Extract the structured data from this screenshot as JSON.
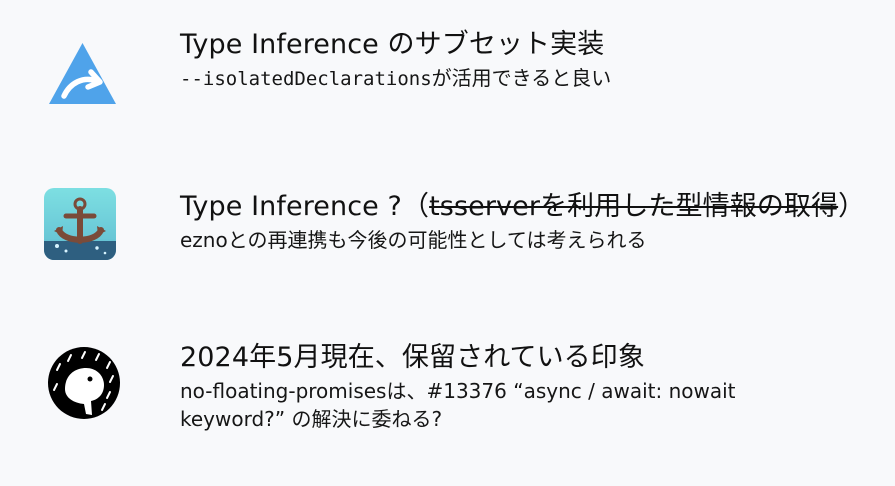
{
  "items": [
    {
      "icon": "typescript-stc-logo-icon",
      "title": "Type Inference のサブセット実装",
      "subtitle_code": "--isolatedDeclarations",
      "subtitle_rest": "が活用できると良い"
    },
    {
      "icon": "anchor-logo-icon",
      "title_prefix": "Type Inference ?（",
      "title_strike": "tsserverを利用した型情報の取得",
      "title_suffix": "）",
      "subtitle": "eznoとの再連携も今後の可能性としては考えられる"
    },
    {
      "icon": "deno-logo-icon",
      "title": "2024年5月現在、保留されている印象",
      "subtitle": "no-floating-promisesは、#13376 “async / await: nowait keyword?” の解決に委ねる?"
    }
  ]
}
